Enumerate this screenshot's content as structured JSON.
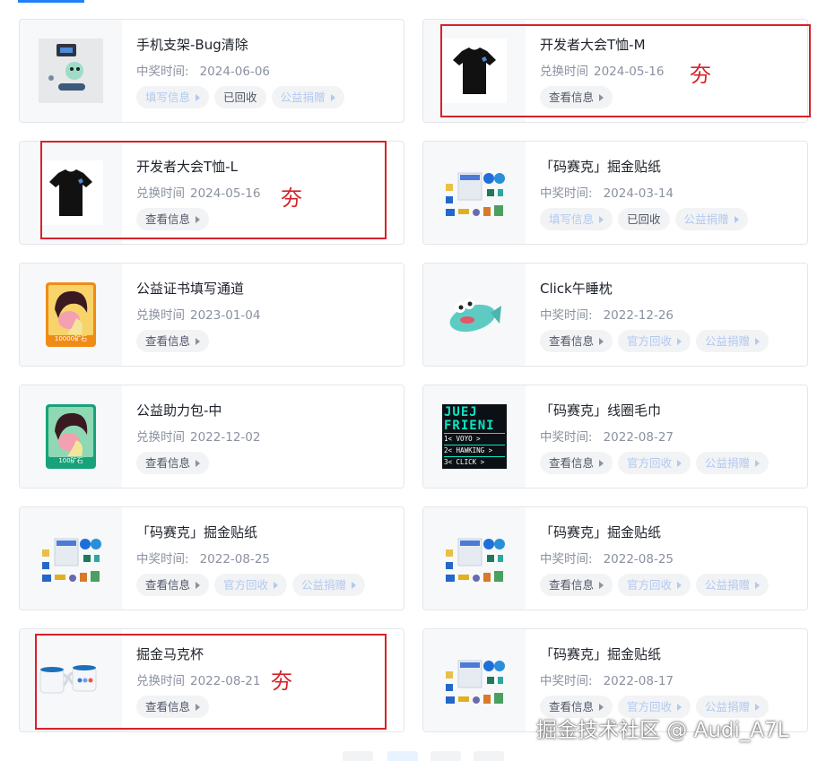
{
  "cards": [
    {
      "title": "手机支架-Bug清除",
      "meta_label": "中奖时间:",
      "date": "2024-06-06",
      "thumb": "phone-stand-image",
      "buttons": [
        {
          "label": "填写信息",
          "state": "disabled"
        },
        {
          "label": "已回收",
          "state": "plain"
        },
        {
          "label": "公益捐赠",
          "state": "disabled"
        }
      ]
    },
    {
      "title": "开发者大会T恤-M",
      "meta_label": "兑换时间",
      "date": "2024-05-16",
      "thumb": "tshirt-image",
      "buttons": [
        {
          "label": "查看信息",
          "state": "active"
        }
      ]
    },
    {
      "title": "开发者大会T恤-L",
      "meta_label": "兑换时间",
      "date": "2024-05-16",
      "thumb": "tshirt-image",
      "buttons": [
        {
          "label": "查看信息",
          "state": "active"
        }
      ]
    },
    {
      "title": "「码赛克」掘金贴纸",
      "meta_label": "中奖时间:",
      "date": "2024-03-14",
      "thumb": "sticker-sheet-image",
      "buttons": [
        {
          "label": "填写信息",
          "state": "disabled"
        },
        {
          "label": "已回收",
          "state": "plain"
        },
        {
          "label": "公益捐赠",
          "state": "disabled"
        }
      ]
    },
    {
      "title": "公益证书填写通道",
      "meta_label": "兑换时间",
      "date": "2023-01-04",
      "thumb": "certificate-orange-image",
      "thumb_caption": "10000矿石",
      "buttons": [
        {
          "label": "查看信息",
          "state": "active"
        }
      ]
    },
    {
      "title": "Click午睡枕",
      "meta_label": "中奖时间:",
      "date": "2022-12-26",
      "thumb": "fish-pillow-image",
      "buttons": [
        {
          "label": "查看信息",
          "state": "active"
        },
        {
          "label": "官方回收",
          "state": "disabled"
        },
        {
          "label": "公益捐赠",
          "state": "disabled"
        }
      ]
    },
    {
      "title": "公益助力包-中",
      "meta_label": "兑换时间",
      "date": "2022-12-02",
      "thumb": "certificate-green-image",
      "thumb_caption": "100矿石",
      "buttons": [
        {
          "label": "查看信息",
          "state": "active"
        }
      ]
    },
    {
      "title": "「码赛克」线圈毛巾",
      "meta_label": "中奖时间:",
      "date": "2022-08-27",
      "thumb": "towel-image",
      "thumb_lines": [
        "JUEJ",
        "FRIENI",
        "1< VOYO >",
        "2< HAWKING >",
        "3< CLICK >"
      ],
      "buttons": [
        {
          "label": "查看信息",
          "state": "active"
        },
        {
          "label": "官方回收",
          "state": "disabled"
        },
        {
          "label": "公益捐赠",
          "state": "disabled"
        }
      ]
    },
    {
      "title": "「码赛克」掘金贴纸",
      "meta_label": "中奖时间:",
      "date": "2022-08-25",
      "thumb": "sticker-sheet-image",
      "buttons": [
        {
          "label": "查看信息",
          "state": "active"
        },
        {
          "label": "官方回收",
          "state": "disabled"
        },
        {
          "label": "公益捐赠",
          "state": "disabled"
        }
      ]
    },
    {
      "title": "「码赛克」掘金贴纸",
      "meta_label": "中奖时间:",
      "date": "2022-08-25",
      "thumb": "sticker-sheet-image",
      "buttons": [
        {
          "label": "查看信息",
          "state": "active"
        },
        {
          "label": "官方回收",
          "state": "disabled"
        },
        {
          "label": "公益捐赠",
          "state": "disabled"
        }
      ]
    },
    {
      "title": "掘金马克杯",
      "meta_label": "兑换时间",
      "date": "2022-08-21",
      "thumb": "mug-image",
      "buttons": [
        {
          "label": "查看信息",
          "state": "active"
        }
      ]
    },
    {
      "title": "「码赛克」掘金贴纸",
      "meta_label": "中奖时间:",
      "date": "2022-08-17",
      "thumb": "sticker-sheet-image",
      "buttons": [
        {
          "label": "查看信息",
          "state": "active"
        },
        {
          "label": "官方回收",
          "state": "disabled"
        },
        {
          "label": "公益捐赠",
          "state": "disabled"
        }
      ]
    }
  ],
  "annotations": {
    "mark": "夯"
  },
  "watermark": "掘金技术社区 @ Audi_A7L",
  "colors": {
    "accent": "#1e80ff",
    "annotation_red": "#d6222b",
    "disabled_text": "#b2c9f0"
  }
}
